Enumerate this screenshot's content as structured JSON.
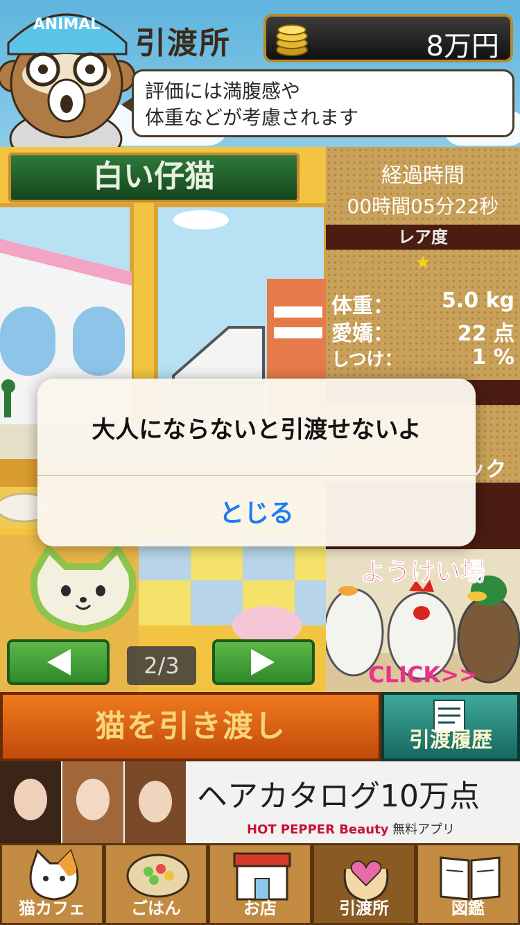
{
  "header": {
    "mascot_badge": "ANIMAL",
    "title": "引渡所",
    "money": "8万円",
    "hint_line1": "評価には満腹感や",
    "hint_line2": "体重などが考慮されます"
  },
  "cat": {
    "name": "白い仔猫",
    "page_indicator": "2/3"
  },
  "info": {
    "elapsed_label": "経過時間",
    "elapsed_value": "00時間05分22秒",
    "rarity_label": "レア度",
    "rarity_stars": "★",
    "stats": [
      {
        "label": "体重：",
        "value": "5.0 kg"
      },
      {
        "label": "愛嬌：",
        "value": "22 点"
      },
      {
        "label": "しつけ：",
        "value": "1 %"
      }
    ],
    "partial_text": "ック"
  },
  "farm_banner": {
    "title": "ようけい場",
    "cta": "CLICK>>"
  },
  "actions": {
    "handover": "猫を引き渡し",
    "history": "引渡履歴"
  },
  "ad": {
    "headline": "ヘアカタログ10万点",
    "brand": "HOT PEPPER Beauty",
    "sub": "無料アプリ"
  },
  "tabs": [
    {
      "label": "猫カフェ",
      "icon": "cat-face-icon"
    },
    {
      "label": "ごはん",
      "icon": "food-bowl-icon"
    },
    {
      "label": "お店",
      "icon": "shop-icon"
    },
    {
      "label": "引渡所",
      "icon": "heart-hands-icon"
    },
    {
      "label": "図鑑",
      "icon": "book-icon"
    }
  ],
  "alert": {
    "message": "大人にならないと引渡せないよ",
    "close_label": "とじる",
    "button_color": "#1c7cf5"
  }
}
